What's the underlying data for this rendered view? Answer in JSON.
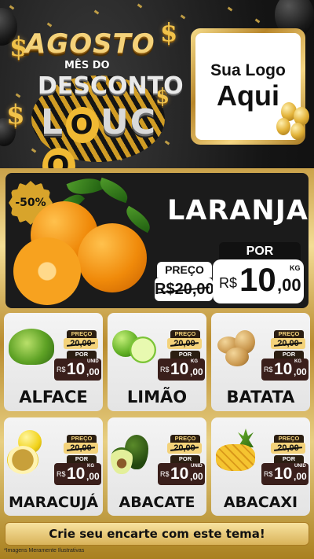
{
  "header": {
    "title_line1": "AGOSTO",
    "title_line2": "MÊS DO",
    "title_line3": "DESCONTO",
    "title_line4_l": "L",
    "title_line4_o": "O",
    "title_line4_u": "U",
    "title_line4_c": "C",
    "title_line4_o2": "O",
    "dollar": "$",
    "logo_line1": "Sua Logo",
    "logo_line2": "Aqui"
  },
  "hero": {
    "badge": "-50%",
    "name": "LARANJA",
    "preco_label": "PREÇO",
    "old_price": "R$20,00",
    "por_label": "POR",
    "currency": "R$",
    "price_int": "10",
    "price_dec": ",00",
    "unit": "KG"
  },
  "products": [
    {
      "name": "ALFACE",
      "preco_label": "PREÇO",
      "old_price": "20,00",
      "por_label": "POR",
      "currency": "R$",
      "price_int": "10",
      "price_dec": ",00",
      "unit": "UNID"
    },
    {
      "name": "LIMÃO",
      "preco_label": "PREÇO",
      "old_price": "20,00",
      "por_label": "POR",
      "currency": "R$",
      "price_int": "10",
      "price_dec": ",00",
      "unit": "KG"
    },
    {
      "name": "BATATA",
      "preco_label": "PREÇO",
      "old_price": "20,00",
      "por_label": "POR",
      "currency": "R$",
      "price_int": "10",
      "price_dec": ",00",
      "unit": "KG"
    },
    {
      "name": "MARACUJÁ",
      "preco_label": "PREÇO",
      "old_price": "20,00",
      "por_label": "POR",
      "currency": "R$",
      "price_int": "10",
      "price_dec": ",00",
      "unit": "KG"
    },
    {
      "name": "ABACATE",
      "preco_label": "PREÇO",
      "old_price": "20,00",
      "por_label": "POR",
      "currency": "R$",
      "price_int": "10",
      "price_dec": ",00",
      "unit": "UNID"
    },
    {
      "name": "ABACAXI",
      "preco_label": "PREÇO",
      "old_price": "20,00",
      "por_label": "POR",
      "currency": "R$",
      "price_int": "10",
      "price_dec": ",00",
      "unit": "UNID"
    }
  ],
  "footer": {
    "cta": "Crie seu encarte com este tema!",
    "disclaimer": "*Imagens Meramente Ilustrativas"
  },
  "colors": {
    "gold": "#d9b35a",
    "dark": "#1b1b1b",
    "price_bg": "#3a1f1b"
  }
}
